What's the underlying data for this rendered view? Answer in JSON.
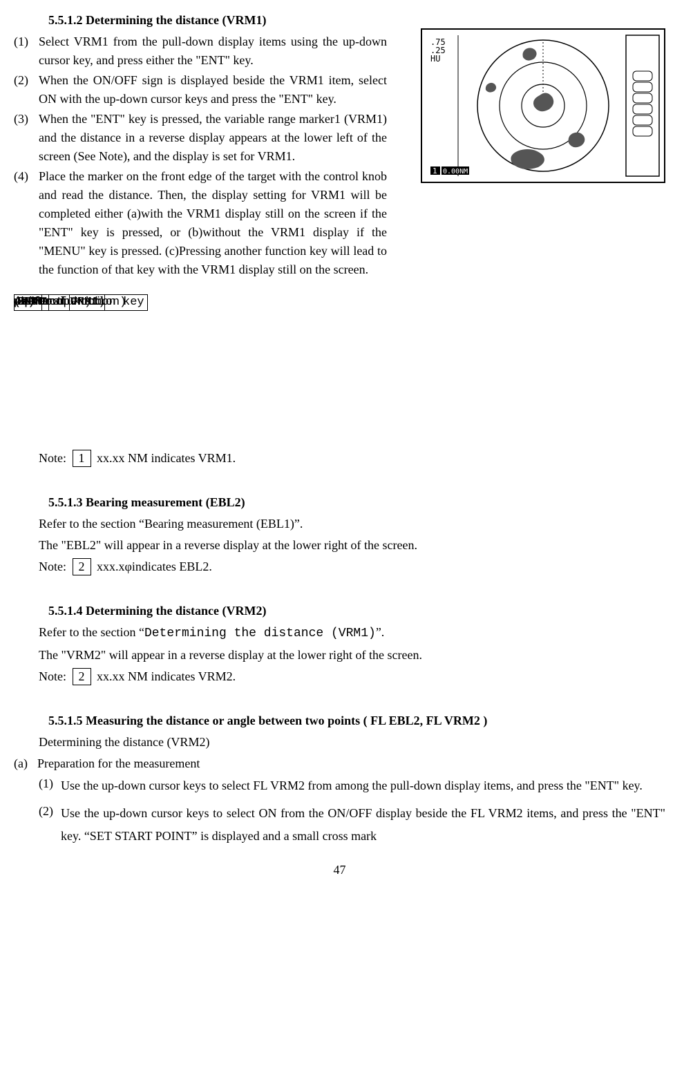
{
  "sec512": {
    "heading": "5.5.1.2 Determining the distance (VRM1)",
    "p1_num": "(1)",
    "p1": "Select VRM1 from the pull-down display items using the up-down cursor key, and press either the \"ENT\" key.",
    "p2_num": "(2)",
    "p2": "When the ON/OFF sign is displayed beside the VRM1 item, select ON with the up-down cursor keys and press the \"ENT\" key.",
    "p3_num": "(3)",
    "p3": "When the \"ENT\" key is pressed, the variable range marker1 (VRM1) and the distance in a reverse display appears at the lower left of the screen (See Note), and the display is set for VRM1.",
    "p4_num": "(4)",
    "p4": "Place the marker on the front edge of the target with the control knob and read the distance.  Then, the display setting for VRM1 will be completed either (a)with the VRM1 display still on the screen if the \"ENT\" key is pressed, or (b)without the VRM1 display if the \"MENU\" key is pressed.  (c)Pressing another function key will lead to the function of that key with the VRM1 display still on the screen."
  },
  "flow": {
    "up_down": "Up/Down",
    "ent": "ENT",
    "control_knob": "Control knob",
    "menu": "MENU",
    "other": "Other function key",
    "select_vrm1": "(Select VRM1)",
    "select_on": "(Select ON)",
    "vrm1_op": "(VRM1 operation)",
    "a": "(a)",
    "b": "(b)",
    "c": "(c)",
    "mu": "μ>"
  },
  "note512": {
    "label": "Note:",
    "box": "1",
    "text": " xx.xx NM indicates VRM1."
  },
  "sec513": {
    "heading": "5.5.1.3 Bearing measurement (EBL2)",
    "line1": "Refer to the section “Bearing measurement (EBL1)”.",
    "line2": "The \"EBL2\" will appear in a reverse display at the lower right of the screen.",
    "note_label": "Note:",
    "note_box": "2",
    "note_text": " xxx.xφindicates EBL2."
  },
  "sec514": {
    "heading": "5.5.1.4 Determining the distance (VRM2)",
    "line1a": "Refer to the section “",
    "line1b": "Determining the distance (VRM1)",
    "line1c": "”.",
    "line2": "The \"VRM2\" will appear in a reverse display at the lower right of the screen.",
    "note_label": "Note:",
    "note_box": "2",
    "note_text": " xx.xx NM indicates VRM2."
  },
  "sec515": {
    "heading": "5.5.1.5 Measuring the distance or angle between two points ( FL EBL2, FL VRM2 )",
    "sub1": "Determining the distance (VRM2)",
    "a_num": "(a)",
    "a_text": "Preparation for the measurement",
    "s1_num": "(1)",
    "s1": "Use the up-down cursor keys to select FL VRM2 from among the pull-down display items, and press the \"ENT\" key.",
    "s2_num": "(2)",
    "s2": "Use the up-down cursor keys to select ON from the ON/OFF display beside the FL VRM2 items, and press the \"ENT\" key. “SET START POINT” is displayed and a small cross mark"
  },
  "radar": {
    "r1": ".75",
    "r2": ".25",
    "hu": "HU",
    "nm": "0.00NM",
    "one": "1"
  },
  "page": "47"
}
